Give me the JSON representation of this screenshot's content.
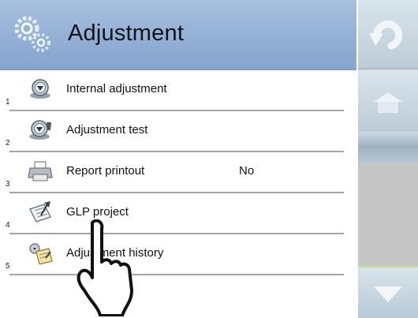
{
  "header": {
    "title": "Adjustment",
    "icon": "gears-icon"
  },
  "menu": [
    {
      "num": "1",
      "label": "Internal adjustment",
      "value": "",
      "icon": "scale-drop-icon"
    },
    {
      "num": "2",
      "label": "Adjustment test",
      "value": "",
      "icon": "scale-check-icon"
    },
    {
      "num": "3",
      "label": "Report printout",
      "value": "No",
      "icon": "printer-icon"
    },
    {
      "num": "4",
      "label": "GLP project",
      "value": "",
      "icon": "glp-document-icon"
    },
    {
      "num": "5",
      "label": "Adjustment history",
      "value": "",
      "icon": "history-notepad-icon"
    }
  ],
  "sidebar": {
    "buttons": [
      "back-arrow-icon",
      "home-icon",
      "scroll-bar-icon",
      "scroll-down-icon"
    ]
  },
  "colors": {
    "header": "#91aed4",
    "sidebar_button": "#c8d6e1",
    "active_border": "#c5e08b"
  }
}
